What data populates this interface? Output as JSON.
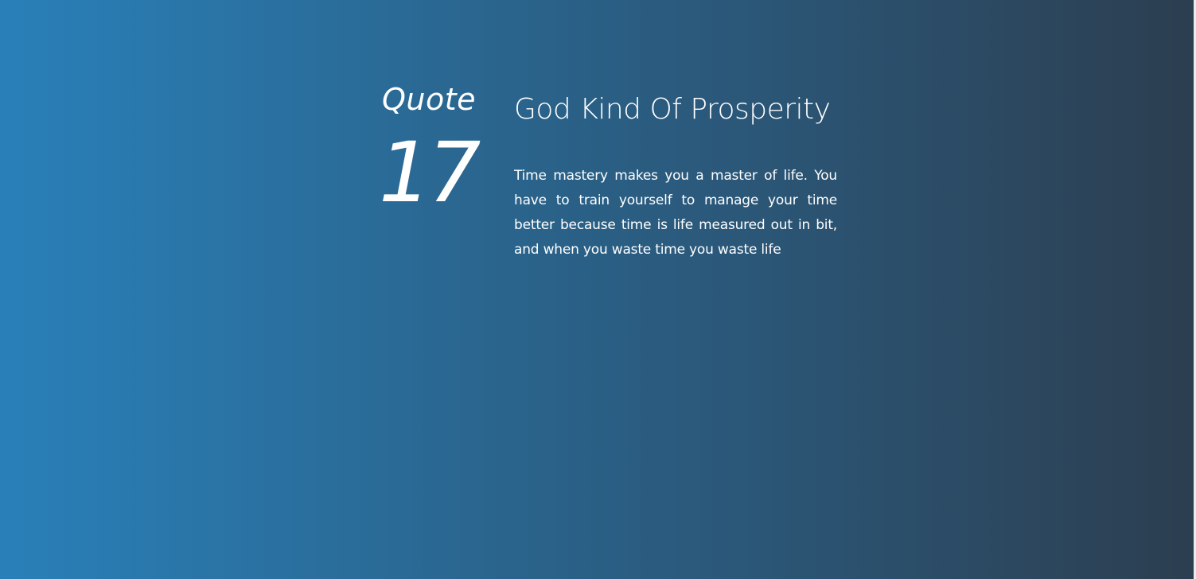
{
  "quote": {
    "label": "Quote",
    "number": "17"
  },
  "article": {
    "title": "God Kind Of Prosperity",
    "body": "Time mastery makes you a master of life. You have to train yourself to manage your time better because time is life measured out in bit, and when you waste time you waste life"
  },
  "colors": {
    "gradient_start": "#2980b9",
    "gradient_end": "#2c3e50",
    "text": "#ffffff"
  }
}
